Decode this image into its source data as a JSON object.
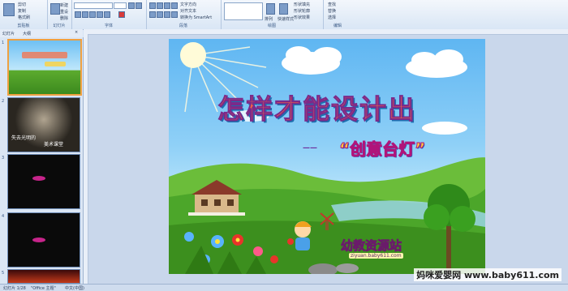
{
  "ribbon": {
    "groups": [
      "剪贴板",
      "幻灯片",
      "字体",
      "段落",
      "绘图",
      "编辑"
    ],
    "items": [
      "剪切",
      "复制",
      "格式刷",
      "新建",
      "幻灯片",
      "重设",
      "删除",
      "文字方向",
      "对齐文本",
      "转换为 SmartArt",
      "排列",
      "快速样式",
      "形状填充",
      "形状轮廓",
      "形状效果",
      "查找",
      "替换",
      "选择"
    ]
  },
  "panel": {
    "tabs": [
      "幻灯片",
      "大纲"
    ],
    "thumb_numbers": [
      "1",
      "2",
      "3",
      "4",
      "5"
    ],
    "thumb2_texts": [
      "失去光明的",
      "美术课堂"
    ]
  },
  "slide": {
    "title": "怎样才能设计出",
    "dash": "——",
    "subtitle": "“创意台灯”",
    "logo": "幼教资源站",
    "logo_url": "ziyuan.baby611.com"
  },
  "status": {
    "slide_info": "幻灯片 1/28",
    "theme": "\"Office 主题\"",
    "language": "中文(中国)"
  },
  "watermark": "妈咪爱婴网 www.baby611.com"
}
